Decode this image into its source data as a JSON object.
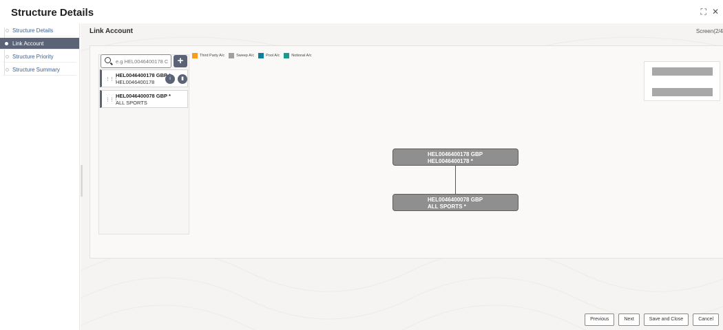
{
  "header": {
    "title": "Structure Details"
  },
  "sidebar": {
    "items": [
      {
        "label": "Structure Details"
      },
      {
        "label": "Link Account"
      },
      {
        "label": "Structure Priority"
      },
      {
        "label": "Structure Summary"
      }
    ]
  },
  "main": {
    "title": "Link Account",
    "screen_indicator": "Screen(2/4"
  },
  "search": {
    "placeholder": "e.g HEL0046400178 C"
  },
  "legend": [
    {
      "label": "Third Party A/c",
      "color": "#f59c1a"
    },
    {
      "label": "Sweep A/c",
      "color": "#a0a0a0"
    },
    {
      "label": "Pool A/c",
      "color": "#0f7e99"
    },
    {
      "label": "Notional A/c",
      "color": "#1a9b8c"
    }
  ],
  "accounts": [
    {
      "line1": "HEL0046400178 GBP *",
      "line2": "HEL0046400178"
    },
    {
      "line1": "HEL0046400078 GBP *",
      "line2": "ALL SPORTS"
    }
  ],
  "tree": {
    "parent": {
      "line1": "HEL0046400178 GBP",
      "line2": "HEL0046400178 *"
    },
    "child": {
      "line1": "HEL0046400078 GBP",
      "line2": "ALL SPORTS *"
    }
  },
  "footer": {
    "previous": "Previous",
    "next": "Next",
    "save_close": "Save and Close",
    "cancel": "Cancel"
  }
}
